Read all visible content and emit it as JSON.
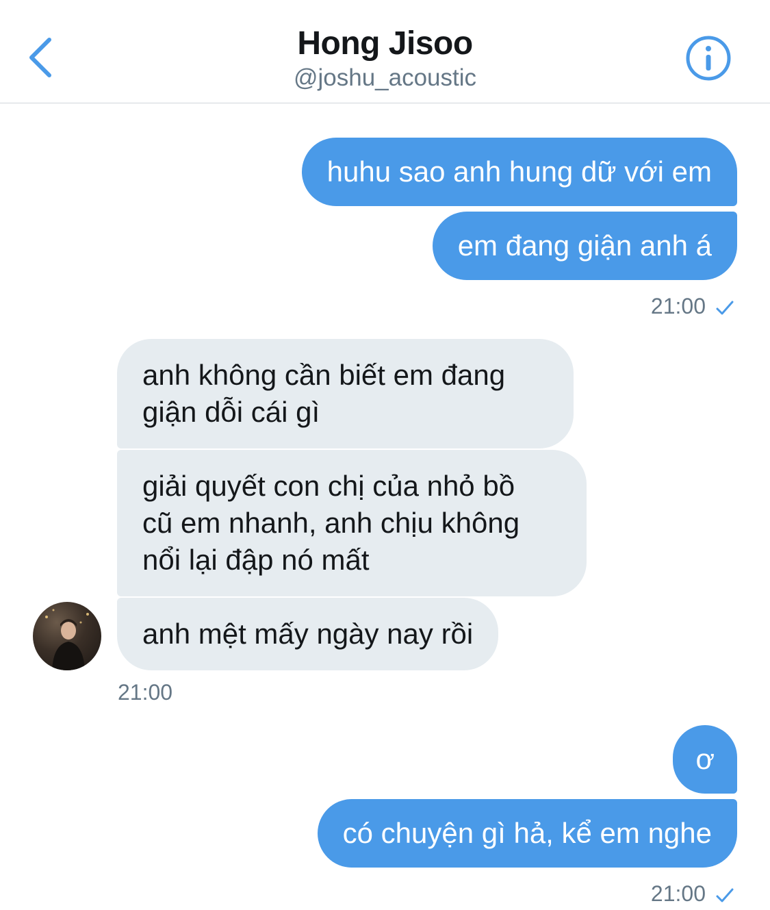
{
  "header": {
    "title": "Hong Jisoo",
    "handle": "@joshu_acoustic",
    "back_icon": "chevron-left-icon",
    "info_icon": "info-icon",
    "accent_color": "#4a9ae8"
  },
  "messages": [
    {
      "direction": "outgoing",
      "text": "huhu sao anh hung dữ với em"
    },
    {
      "direction": "outgoing",
      "text": "em đang giận anh á"
    },
    {
      "direction": "incoming",
      "text": "anh không cần biết em đang\ngiận dỗi cái gì"
    },
    {
      "direction": "incoming",
      "text": "giải quyết con chị của nhỏ bồ\ncũ em nhanh, anh chịu không\nnổi lại đập nó mất"
    },
    {
      "direction": "incoming",
      "text": "anh mệt mấy ngày nay rồi"
    },
    {
      "direction": "outgoing",
      "text": "ơ"
    },
    {
      "direction": "outgoing",
      "text": "có chuyện gì hả, kể em nghe"
    }
  ],
  "timestamps": {
    "group1": "21:00",
    "group2": "21:00",
    "group3": "21:00"
  },
  "colors": {
    "outgoing_bubble": "#4a9ae8",
    "incoming_bubble": "#e6ecf0",
    "timestamp_text": "#657786"
  }
}
